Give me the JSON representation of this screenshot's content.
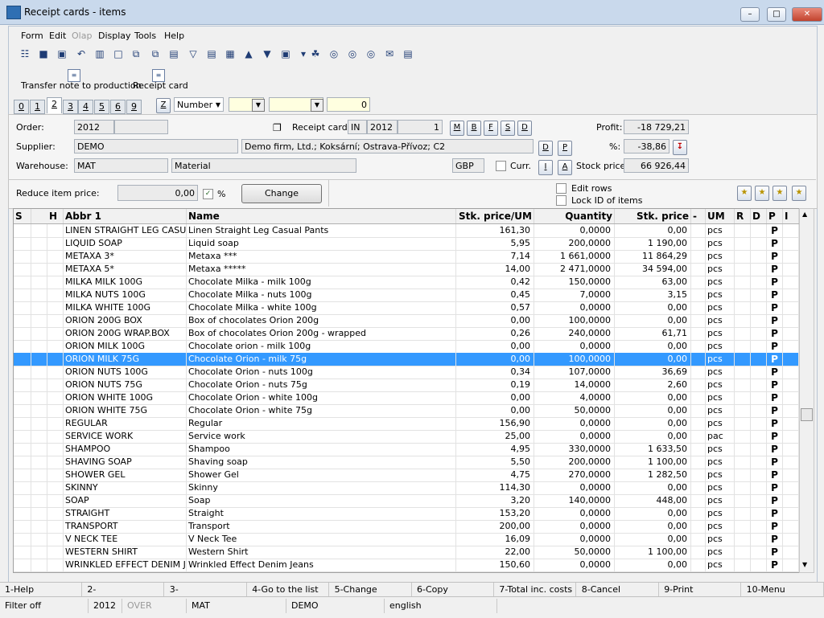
{
  "window": {
    "title": "Receipt cards - items"
  },
  "menu": [
    "Form",
    "Edit",
    "Olap",
    "Display",
    "Tools",
    "Help"
  ],
  "toolbar_icons": [
    "tree-icon",
    "save-icon",
    "save-as-icon",
    "undo-icon",
    "open-folder-icon",
    "new-icon",
    "copy-icon",
    "paste-icon",
    "book-icon",
    "filter-icon",
    "filter-list-icon",
    "layers-icon",
    "arrow-up-icon",
    "arrow-down-icon",
    "camera-icon",
    "dropdown-icon",
    "leaf-icon",
    "binoculars-icon",
    "binoculars-next-icon",
    "binoculars-prev-icon",
    "mail-icon",
    "notepad-icon"
  ],
  "big_buttons": {
    "transfer": "Transfer note to production",
    "receipt": "Receipt card"
  },
  "tabs": [
    "0",
    "1",
    "2",
    "3",
    "4",
    "5",
    "6",
    "9"
  ],
  "tab_active": "2",
  "z_button": "Z",
  "sort_select": "Number",
  "sort_value": "0",
  "header": {
    "order_label": "Order:",
    "order_value": "2012",
    "receipt_label": "Receipt card:",
    "receipt_type": "IN",
    "receipt_year": "2012",
    "receipt_no": "1",
    "receipt_btns": [
      "M",
      "B",
      "F",
      "S",
      "D"
    ],
    "profit_label": "Profit:",
    "profit_value": "-18 729,21",
    "supplier_label": "Supplier:",
    "supplier_code": "DEMO",
    "supplier_name": "Demo firm, Ltd.; Koksární; Ostrava-Přívoz; C2",
    "supplier_btns": [
      "D",
      "P"
    ],
    "pct_label": "%:",
    "pct_value": "-38,86",
    "warehouse_label": "Warehouse:",
    "warehouse_code": "MAT",
    "warehouse_name": "Material",
    "currency": "GBP",
    "curr_label": "Curr.",
    "wh_btns": [
      "I",
      "A"
    ],
    "stock_label": "Stock price:",
    "stock_value": "66 926,44",
    "reduce_label": "Reduce item price:",
    "reduce_value": "0,00",
    "reduce_unit": "%",
    "change_btn": "Change",
    "edit_rows": "Edit rows",
    "lock_id": "Lock ID of items"
  },
  "columns": [
    "S",
    "H",
    "Abbr 1",
    "Name",
    "Stk. price/UM",
    "Quantity",
    "Stk. price",
    "-",
    "UM",
    "R",
    "D",
    "P",
    "I"
  ],
  "rows": [
    {
      "abbr": "LINEN STRAIGHT LEG CASU...",
      "name": "Linen Straight Leg Casual Pants",
      "price": "161,30",
      "qty": "0,0000",
      "stk": "0,00",
      "um": "pcs",
      "p": "P"
    },
    {
      "abbr": "LIQUID SOAP",
      "name": "Liquid soap",
      "price": "5,95",
      "qty": "200,0000",
      "stk": "1 190,00",
      "um": "pcs",
      "p": "P"
    },
    {
      "abbr": "METAXA 3*",
      "name": "Metaxa ***",
      "price": "7,14",
      "qty": "1 661,0000",
      "stk": "11 864,29",
      "um": "pcs",
      "p": "P"
    },
    {
      "abbr": "METAXA 5*",
      "name": "Metaxa *****",
      "price": "14,00",
      "qty": "2 471,0000",
      "stk": "34 594,00",
      "um": "pcs",
      "p": "P"
    },
    {
      "abbr": "MILKA MILK 100G",
      "name": "Chocolate Milka - milk 100g",
      "price": "0,42",
      "qty": "150,0000",
      "stk": "63,00",
      "um": "pcs",
      "p": "P"
    },
    {
      "abbr": "MILKA NUTS 100G",
      "name": "Chocolate Milka - nuts 100g",
      "price": "0,45",
      "qty": "7,0000",
      "stk": "3,15",
      "um": "pcs",
      "p": "P"
    },
    {
      "abbr": "MILKA WHITE 100G",
      "name": "Chocolate Milka - white 100g",
      "price": "0,57",
      "qty": "0,0000",
      "stk": "0,00",
      "um": "pcs",
      "p": "P"
    },
    {
      "abbr": "ORION 200G BOX",
      "name": "Box of chocolates Orion 200g",
      "price": "0,00",
      "qty": "100,0000",
      "stk": "0,00",
      "um": "pcs",
      "p": "P"
    },
    {
      "abbr": "ORION 200G WRAP.BOX",
      "name": "Box of chocolates Orion 200g - wrapped",
      "price": "0,26",
      "qty": "240,0000",
      "stk": "61,71",
      "um": "pcs",
      "p": "P"
    },
    {
      "abbr": "ORION MILK 100G",
      "name": "Chocolate orion - milk 100g",
      "price": "0,00",
      "qty": "0,0000",
      "stk": "0,00",
      "um": "pcs",
      "p": "P"
    },
    {
      "abbr": "ORION MILK 75G",
      "name": "Chocolate Orion - milk 75g",
      "price": "0,00",
      "qty": "100,0000",
      "stk": "0,00",
      "um": "pcs",
      "p": "P",
      "selected": true
    },
    {
      "abbr": "ORION NUTS 100G",
      "name": "Chocolate Orion - nuts 100g",
      "price": "0,34",
      "qty": "107,0000",
      "stk": "36,69",
      "um": "pcs",
      "p": "P"
    },
    {
      "abbr": "ORION NUTS 75G",
      "name": "Chocolate Orion - nuts 75g",
      "price": "0,19",
      "qty": "14,0000",
      "stk": "2,60",
      "um": "pcs",
      "p": "P"
    },
    {
      "abbr": "ORION WHITE 100G",
      "name": "Chocolate Orion - white 100g",
      "price": "0,00",
      "qty": "4,0000",
      "stk": "0,00",
      "um": "pcs",
      "p": "P"
    },
    {
      "abbr": "ORION WHITE 75G",
      "name": "Chocolate Orion - white 75g",
      "price": "0,00",
      "qty": "50,0000",
      "stk": "0,00",
      "um": "pcs",
      "p": "P"
    },
    {
      "abbr": "REGULAR",
      "name": "Regular",
      "price": "156,90",
      "qty": "0,0000",
      "stk": "0,00",
      "um": "pcs",
      "p": "P"
    },
    {
      "abbr": "SERVICE WORK",
      "name": "Service work",
      "price": "25,00",
      "qty": "0,0000",
      "stk": "0,00",
      "um": "pac",
      "p": "P"
    },
    {
      "abbr": "SHAMPOO",
      "name": "Shampoo",
      "price": "4,95",
      "qty": "330,0000",
      "stk": "1 633,50",
      "um": "pcs",
      "p": "P"
    },
    {
      "abbr": "SHAVING SOAP",
      "name": "Shaving soap",
      "price": "5,50",
      "qty": "200,0000",
      "stk": "1 100,00",
      "um": "pcs",
      "p": "P"
    },
    {
      "abbr": "SHOWER GEL",
      "name": "Shower Gel",
      "price": "4,75",
      "qty": "270,0000",
      "stk": "1 282,50",
      "um": "pcs",
      "p": "P"
    },
    {
      "abbr": "SKINNY",
      "name": "Skinny",
      "price": "114,30",
      "qty": "0,0000",
      "stk": "0,00",
      "um": "pcs",
      "p": "P"
    },
    {
      "abbr": "SOAP",
      "name": "Soap",
      "price": "3,20",
      "qty": "140,0000",
      "stk": "448,00",
      "um": "pcs",
      "p": "P"
    },
    {
      "abbr": "STRAIGHT",
      "name": "Straight",
      "price": "153,20",
      "qty": "0,0000",
      "stk": "0,00",
      "um": "pcs",
      "p": "P"
    },
    {
      "abbr": "TRANSPORT",
      "name": "Transport",
      "price": "200,00",
      "qty": "0,0000",
      "stk": "0,00",
      "um": "pcs",
      "p": "P"
    },
    {
      "abbr": "V NECK TEE",
      "name": "V Neck Tee",
      "price": "16,09",
      "qty": "0,0000",
      "stk": "0,00",
      "um": "pcs",
      "p": "P"
    },
    {
      "abbr": "WESTERN SHIRT",
      "name": "Western Shirt",
      "price": "22,00",
      "qty": "50,0000",
      "stk": "1 100,00",
      "um": "pcs",
      "p": "P"
    },
    {
      "abbr": "WRINKLED EFFECT DENIM J...",
      "name": "Wrinkled Effect Denim Jeans",
      "price": "150,60",
      "qty": "0,0000",
      "stk": "0,00",
      "um": "pcs",
      "p": "P"
    }
  ],
  "fkeys": [
    "1-Help",
    "2-",
    "3-Refresh/Restore",
    "4-Go to the list",
    "5-Change",
    "6-Copy",
    "7-Total inc. costs",
    "8-Cancel",
    "9-Print",
    "10-Menu"
  ],
  "status": {
    "filter": "Filter off",
    "year": "2012",
    "over": "OVER",
    "wh": "MAT",
    "firm": "DEMO",
    "lang": "english"
  },
  "colors": {
    "selection": "#3399ff",
    "titlebar": "#c9d9ec"
  }
}
